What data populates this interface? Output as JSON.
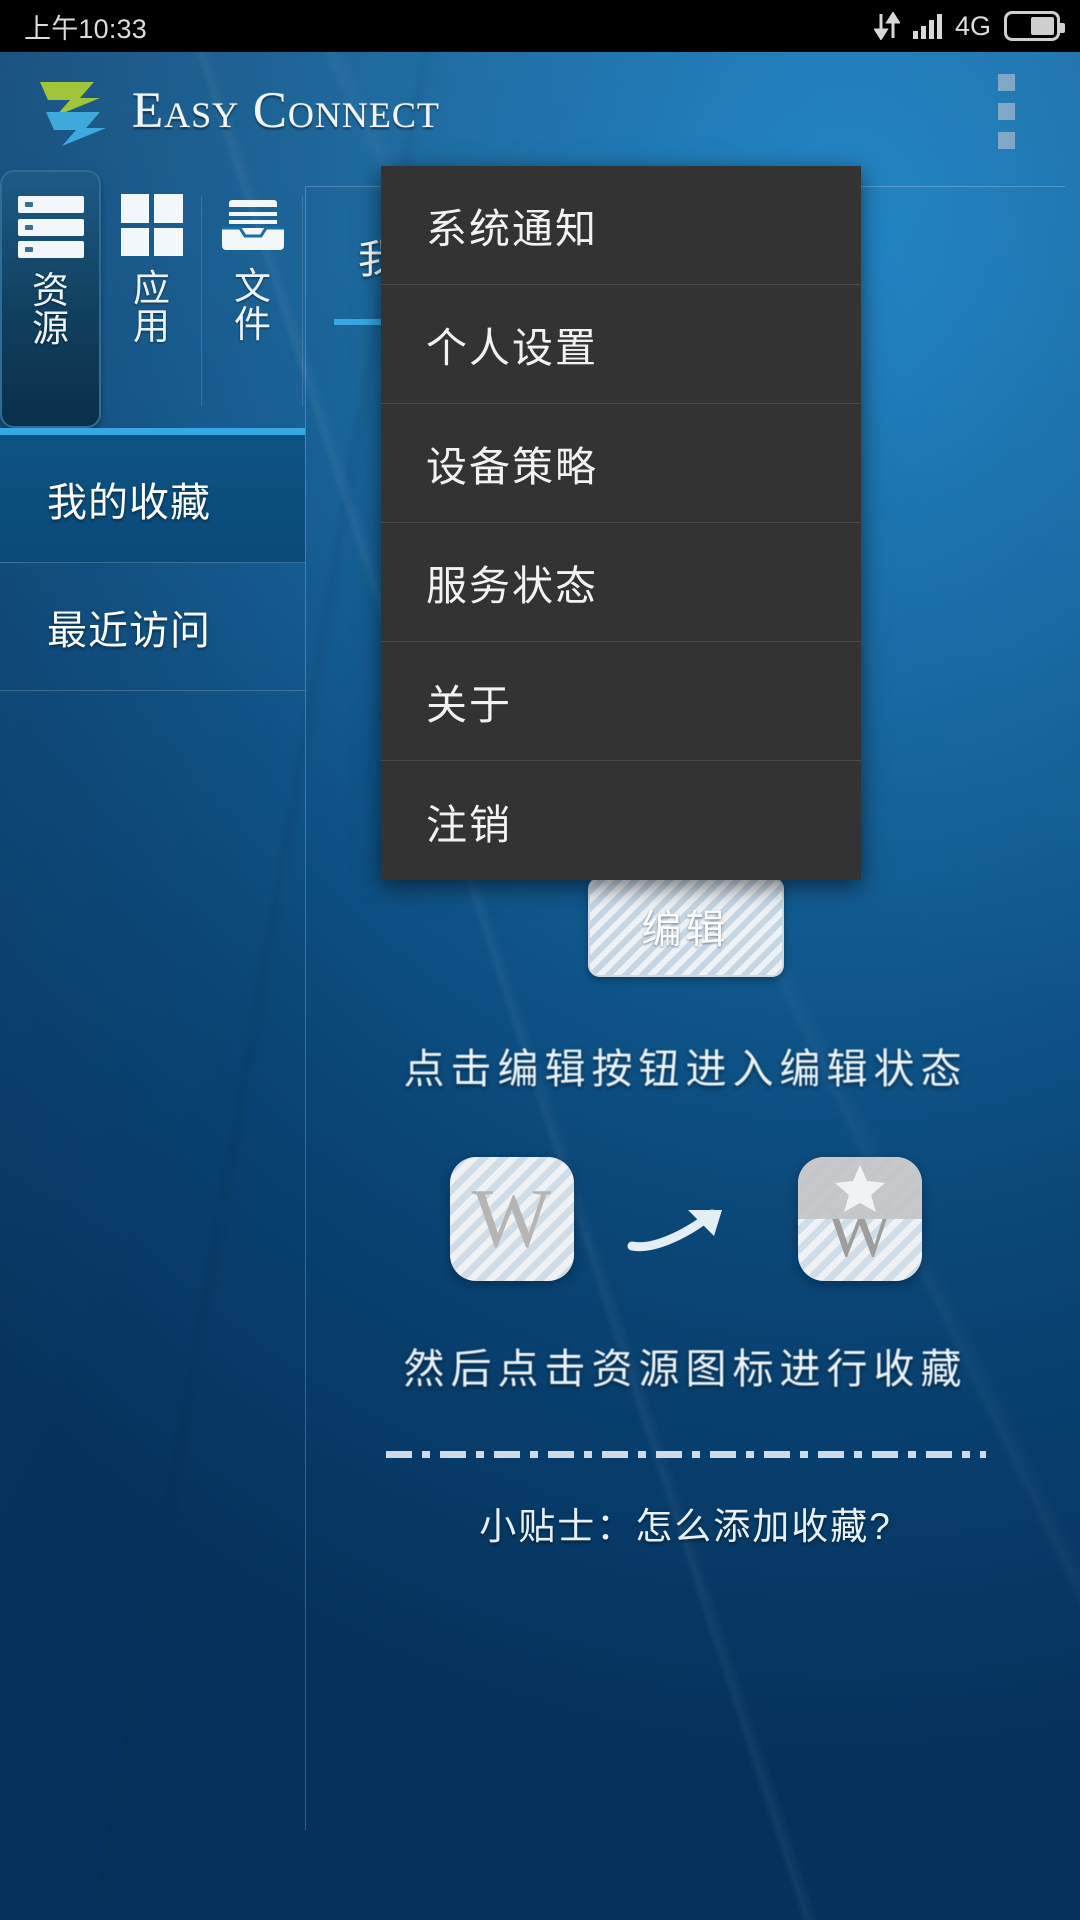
{
  "status_bar": {
    "time": "上午10:33",
    "network": "4G",
    "icons": [
      "data-transfer-icon",
      "signal-icon",
      "battery-icon"
    ]
  },
  "app_bar": {
    "brand": "Easy Connect",
    "logo_icon": "easy-connect-logo",
    "overflow_icon": "overflow-menu-icon"
  },
  "tabs": [
    {
      "label": "资源",
      "icon": "server-list-icon",
      "active": true
    },
    {
      "label": "应用",
      "icon": "grid-apps-icon",
      "active": false
    },
    {
      "label": "文件",
      "icon": "file-tray-icon",
      "active": false
    }
  ],
  "sidebar": {
    "items": [
      {
        "label": "我的收藏",
        "active": true
      },
      {
        "label": "最近访问",
        "active": false
      }
    ]
  },
  "main": {
    "panel_title": "我的收藏",
    "tutorial": {
      "edit_button": "编辑",
      "line1": "点击编辑按钮进入编辑状态",
      "line2": "然后点击资源图标进行收藏",
      "icon_letter": "W",
      "icon_before_name": "resource-icon-plain",
      "icon_after_name": "resource-icon-favorited",
      "arrow_name": "curved-arrow-icon",
      "star_name": "star-badge-icon",
      "tip": "小贴士：怎么添加收藏?"
    }
  },
  "overflow_menu": {
    "visible": true,
    "items": [
      {
        "label": "系统通知"
      },
      {
        "label": "个人设置"
      },
      {
        "label": "设备策略"
      },
      {
        "label": "服务状态"
      },
      {
        "label": "关于"
      },
      {
        "label": "注销"
      }
    ]
  },
  "colors": {
    "accent": "#37a8e4",
    "background_blue": "#0f5e95",
    "menu_bg": "#333333",
    "logo_green": "#9fc63a",
    "logo_blue": "#3fa9dd"
  }
}
